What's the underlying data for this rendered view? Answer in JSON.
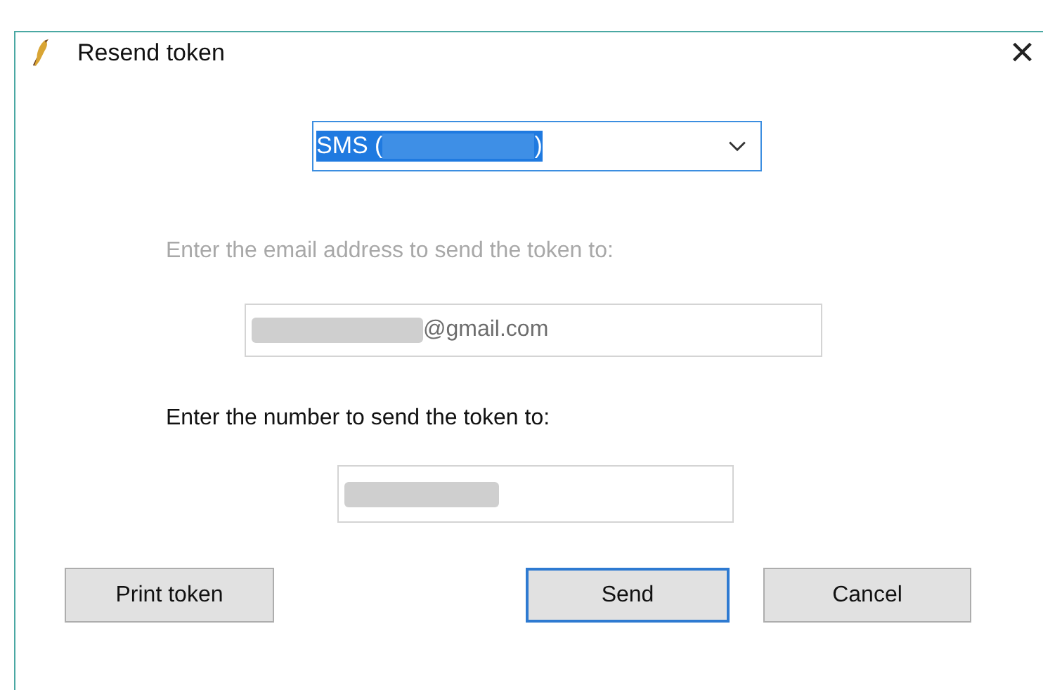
{
  "window": {
    "title": "Resend token",
    "close": "×"
  },
  "method_dropdown": {
    "value_start": "SMS (",
    "value_redacted": true,
    "value_end": ")",
    "text_selected": true
  },
  "email": {
    "label": "Enter the email address to send the token to:",
    "disabled": true,
    "value_redacted": true,
    "value": "@gmail.com"
  },
  "number": {
    "label": "Enter the number to send the token to:",
    "disabled": false,
    "value_redacted": true
  },
  "buttons": [
    {
      "label": "Print token",
      "default": false
    },
    {
      "label": "Send",
      "default": true
    },
    {
      "label": "Cancel",
      "default": false
    }
  ]
}
